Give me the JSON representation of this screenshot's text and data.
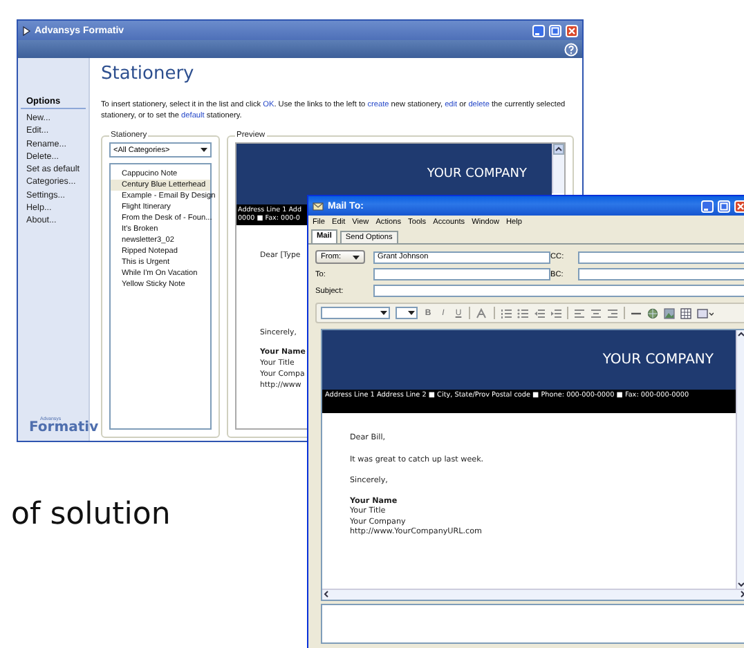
{
  "formativ_window": {
    "title": "Advansys Formativ",
    "sidebar": {
      "heading": "Options",
      "items": [
        "New...",
        "Edit...",
        "Rename...",
        "Delete...",
        "Set as default",
        "Categories...",
        "Settings...",
        "Help...",
        "About..."
      ],
      "logo_small": "Advansys",
      "logo": "Formativ"
    },
    "heading": "Stationery",
    "instructions": [
      {
        "kind": "text",
        "text": "To insert stationery, select it in the list and click "
      },
      {
        "kind": "link",
        "text": "OK"
      },
      {
        "kind": "text",
        "text": ".  Use the links to the left to "
      },
      {
        "kind": "link",
        "text": "create"
      },
      {
        "kind": "text",
        "text": " new stationery, "
      },
      {
        "kind": "link",
        "text": "edit"
      },
      {
        "kind": "text",
        "text": " or "
      },
      {
        "kind": "link",
        "text": "delete"
      },
      {
        "kind": "text",
        "text": " the currently selected stationery, or to set the "
      },
      {
        "kind": "link",
        "text": "default"
      },
      {
        "kind": "text",
        "text": " stationery."
      }
    ],
    "stationery_group": {
      "label": "Stationery",
      "category": "<All Categories>",
      "items": [
        {
          "label": "Cappucino Note",
          "selected": false
        },
        {
          "label": "Century Blue Letterhead",
          "selected": true
        },
        {
          "label": "Example - Email By Design",
          "selected": false
        },
        {
          "label": "Flight Itinerary",
          "selected": false
        },
        {
          "label": "From the Desk of - Foun...",
          "selected": false
        },
        {
          "label": "It's Broken",
          "selected": false
        },
        {
          "label": "newsletter3_02",
          "selected": false
        },
        {
          "label": "Ripped Notepad",
          "selected": false
        },
        {
          "label": "This is Urgent",
          "selected": false
        },
        {
          "label": "While I'm On Vacation",
          "selected": false
        },
        {
          "label": "Yellow Sticky Note",
          "selected": false
        }
      ]
    },
    "preview_group": {
      "label": "Preview",
      "company": "YOUR COMPANY",
      "address_lines": [
        "Address Line 1 Add",
        "0000 ■ Fax: 000-0"
      ],
      "greeting": "Dear [Type",
      "closing": "Sincerely,",
      "signature_name": "Your Name",
      "signature_lines": [
        "Your Title",
        "Your Compa",
        "http://www"
      ]
    }
  },
  "mail_window": {
    "title": "Mail To:",
    "menu": [
      "File",
      "Edit",
      "View",
      "Actions",
      "Tools",
      "Accounts",
      "Window",
      "Help"
    ],
    "tabs": [
      {
        "label": "Mail",
        "selected": true
      },
      {
        "label": "Send Options",
        "selected": false
      }
    ],
    "from": {
      "label": "From:",
      "value": "Grant Johnson"
    },
    "cc": {
      "label": "CC:"
    },
    "to": {
      "label": "To:"
    },
    "bc": {
      "label": "BC:"
    },
    "subject": {
      "label": "Subject:"
    },
    "format_buttons": [
      "B",
      "I",
      "U"
    ],
    "letter": {
      "company": "YOUR COMPANY",
      "address": "Address Line 1 Address Line 2 ■ City, State/Prov Postal code ■ Phone: 000-000-0000 ■ Fax: 000-000-0000",
      "greeting": "Dear Bill,",
      "body": "It was great to catch up last week.",
      "closing": "Sincerely,",
      "signature_name": "Your Name",
      "signature_lines": [
        "Your Title",
        "Your Company",
        "http://www.YourCompanyURL.com"
      ]
    }
  },
  "tagline": "of solution"
}
